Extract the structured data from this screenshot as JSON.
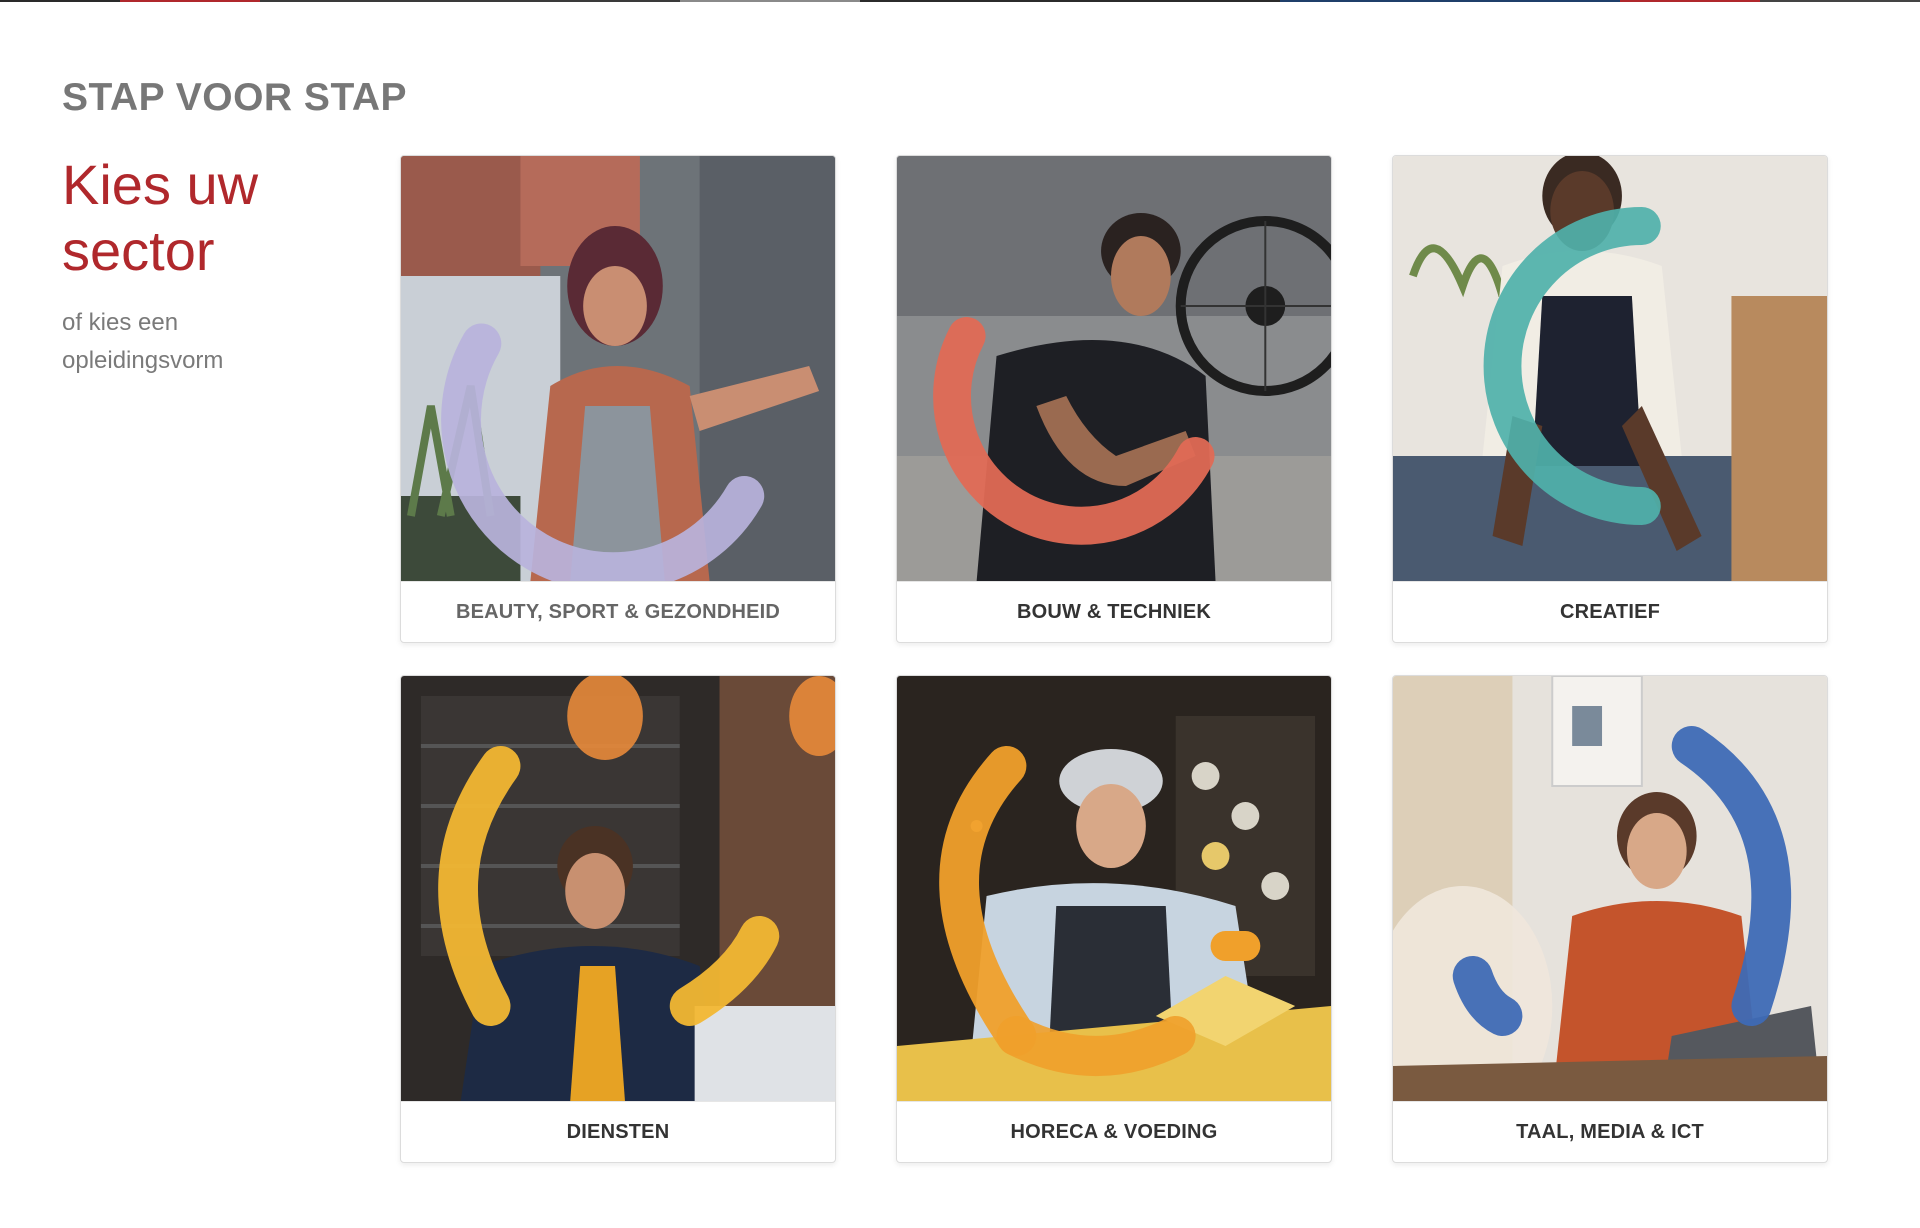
{
  "section": {
    "eyebrow": "STAP VOOR STAP",
    "headline": "Kies uw sector",
    "alt_link": "of kies een opleidingsvorm"
  },
  "colors": {
    "brand_red": "#b0282c",
    "beauty_arc": "#b9b3dc",
    "bouw_arc": "#e06a55",
    "creatief_arc": "#4fb1aa",
    "diensten_arc": "#f2b733",
    "horeca_arc": "#f0a02b",
    "taal_arc": "#3e6ab5"
  },
  "sectors": [
    {
      "label": "BEAUTY, SPORT & GEZONDHEID",
      "arc_color": "#b9b3dc"
    },
    {
      "label": "BOUW & TECHNIEK",
      "arc_color": "#e06a55"
    },
    {
      "label": "CREATIEF",
      "arc_color": "#4fb1aa"
    },
    {
      "label": "DIENSTEN",
      "arc_color": "#f2b733"
    },
    {
      "label": "HORECA & VOEDING",
      "arc_color": "#f0a02b"
    },
    {
      "label": "TAAL, MEDIA & ICT",
      "arc_color": "#3e6ab5"
    }
  ]
}
